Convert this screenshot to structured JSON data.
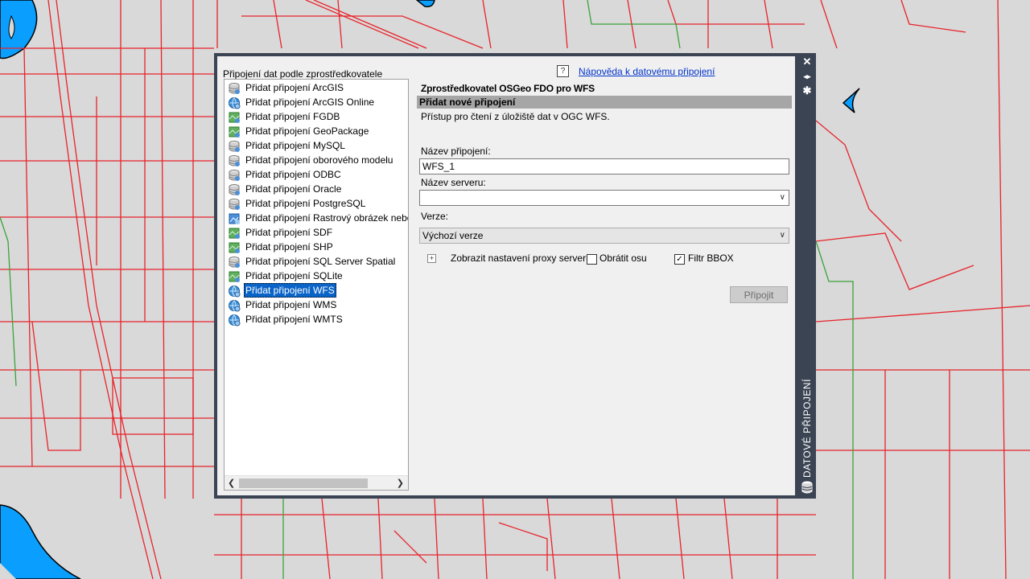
{
  "panel": {
    "title": "Připojení dat podle zprostředkovatele",
    "help_icon": "?",
    "help_link": "Nápověda k datovému připojení",
    "side_title": "DATOVÉ PŘIPOJENÍ",
    "side_buttons": {
      "close": "✕",
      "autohide": "◂▸",
      "properties": "✱"
    }
  },
  "providers": [
    {
      "label": "Přidat připojení ArcGIS",
      "icon": "database-icon"
    },
    {
      "label": "Přidat připojení ArcGIS Online",
      "icon": "globe-icon"
    },
    {
      "label": "Přidat připojení FGDB",
      "icon": "raster-icon"
    },
    {
      "label": "Přidat připojení GeoPackage",
      "icon": "raster-icon"
    },
    {
      "label": "Přidat připojení MySQL",
      "icon": "database-icon"
    },
    {
      "label": "Přidat připojení oborového modelu",
      "icon": "database-icon"
    },
    {
      "label": "Přidat připojení ODBC",
      "icon": "database-icon"
    },
    {
      "label": "Přidat připojení Oracle",
      "icon": "database-icon"
    },
    {
      "label": "Přidat připojení PostgreSQL",
      "icon": "database-icon"
    },
    {
      "label": "Přidat připojení Rastrový obrázek nebo",
      "icon": "image-icon"
    },
    {
      "label": "Přidat připojení SDF",
      "icon": "raster-icon"
    },
    {
      "label": "Přidat připojení SHP",
      "icon": "raster-icon"
    },
    {
      "label": "Přidat připojení SQL Server Spatial",
      "icon": "database-icon"
    },
    {
      "label": "Přidat připojení SQLite",
      "icon": "raster-icon"
    },
    {
      "label": "Přidat připojení WFS",
      "icon": "globe-icon",
      "selected": true
    },
    {
      "label": "Přidat připojení WMS",
      "icon": "globe-icon"
    },
    {
      "label": "Přidat připojení WMTS",
      "icon": "globe-icon"
    }
  ],
  "form": {
    "provider_title": "Zprostředkovatel OSGeo FDO pro WFS",
    "section_title": "Přidat nové připojení",
    "description": "Přístup pro čtení z úložiště dat v OGC WFS.",
    "connection_name_label": "Název připojení:",
    "connection_name_value": "WFS_1",
    "server_name_label": "Název serveru:",
    "server_name_value": "",
    "version_label": "Verze:",
    "version_value": "Výchozí verze",
    "proxy_expander": "⊞",
    "proxy_label": "Zobrazit nastavení proxy serveru",
    "invert_axis_label": "Obrátit osu",
    "invert_axis_checked": false,
    "bbox_filter_label": "Filtr BBOX",
    "bbox_filter_checked": true,
    "connect_button": "Připojit"
  },
  "colors": {
    "map_background": "#d9d9d9",
    "road": "#e8232a",
    "boundary": "#3aa23a",
    "water": "#0a9fff",
    "palette_frame": "#3b4453",
    "selection": "#0a64c8"
  }
}
